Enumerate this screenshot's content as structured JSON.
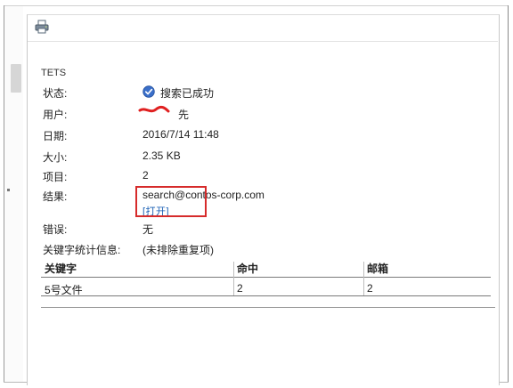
{
  "title": "TETS",
  "fields": {
    "status": {
      "label": "状态:",
      "value": "搜索已成功"
    },
    "user": {
      "label": "用户:",
      "value": "先"
    },
    "date": {
      "label": "日期:",
      "value": "2016/7/14 11:48"
    },
    "size": {
      "label": "大小:",
      "value": "2.35 KB"
    },
    "items": {
      "label": "项目:",
      "value": "2"
    },
    "result": {
      "label": "结果:",
      "value": "search@contos-corp.com",
      "open_link": "[打开]"
    },
    "error": {
      "label": "错误:",
      "value": "无"
    },
    "keyword_stats": {
      "label": "关键字统计信息:",
      "value": "(未排除重复项)"
    }
  },
  "table": {
    "headers": [
      "关键字",
      "命中",
      "邮箱"
    ],
    "rows": [
      [
        "5号文件",
        "2",
        "2"
      ]
    ]
  },
  "icons": {
    "print": "printer-icon",
    "status": "checkmark-circle-icon"
  },
  "colors": {
    "link": "#1a5fb4",
    "highlight_box": "#d62b2b",
    "redaction": "#e02020",
    "status_icon": "#3a6fc9"
  }
}
